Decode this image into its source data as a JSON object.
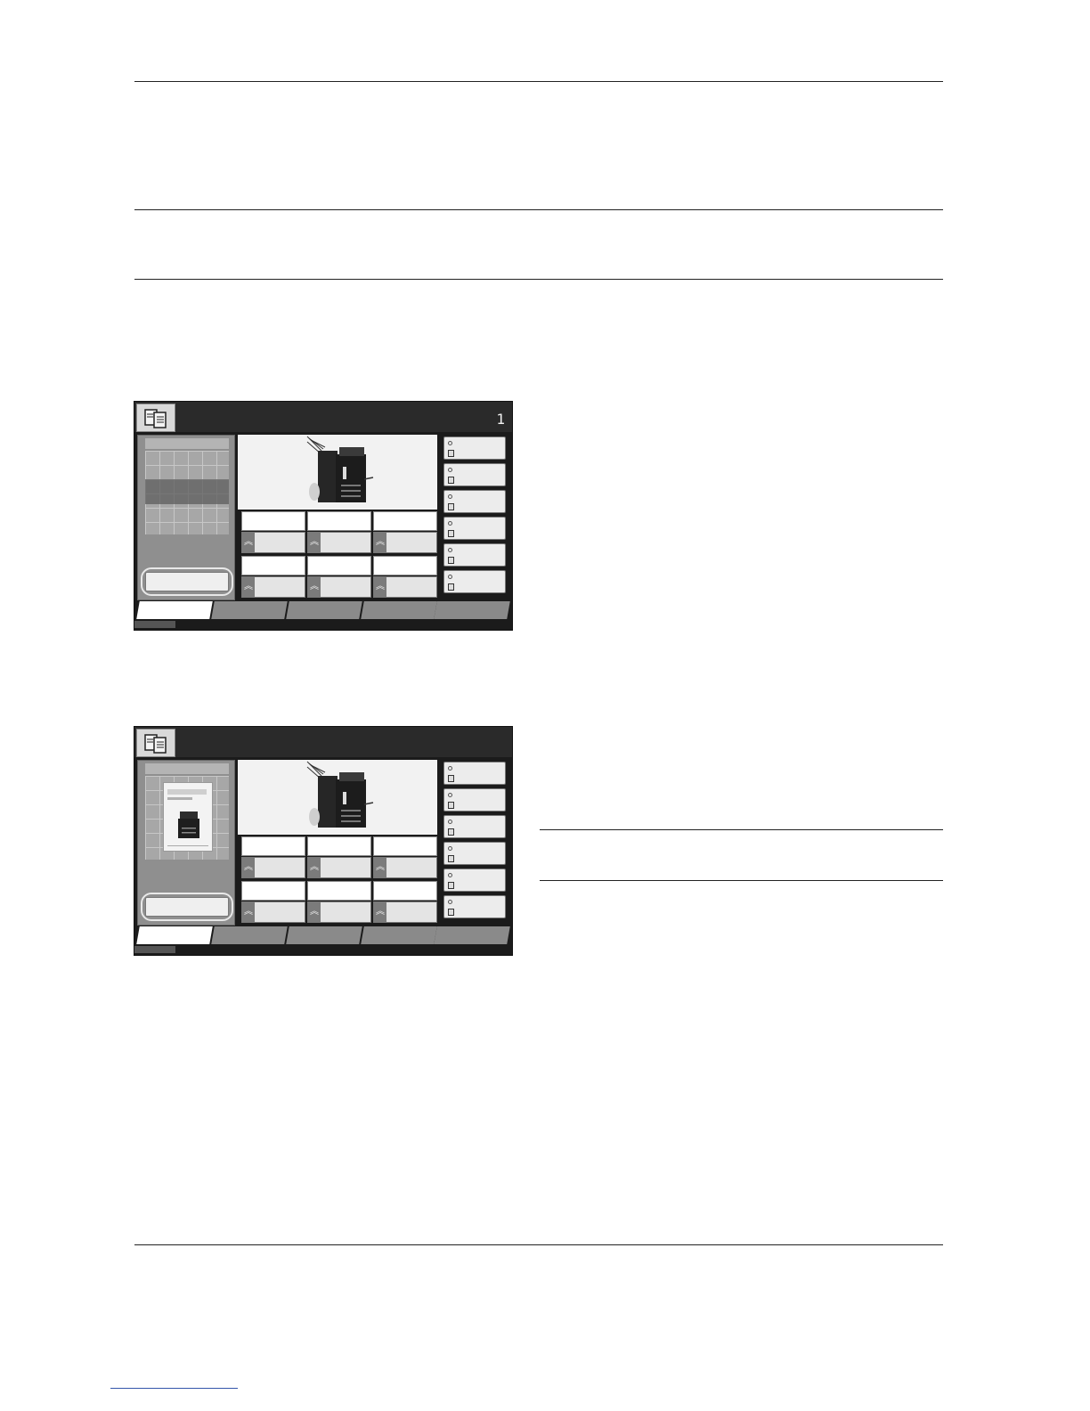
{
  "panels": [
    {
      "copies_count": "1",
      "preview_state": "original-not-scanned",
      "highlighted_key": "preview-button"
    },
    {
      "copies_count": "",
      "preview_state": "preview-displayed",
      "highlighted_key": "preview-button"
    }
  ],
  "icons": {
    "mode": "copy-icon",
    "function_key": "chevron-up-icon",
    "side_key_status": "circle-icon",
    "side_key_favorite": "favorite-icon"
  },
  "colors": {
    "screen_frame": "#1b1b1b",
    "title_bar": "#2a2a2a",
    "page_rule": "#222222",
    "footer_link_rule": "#3355aa"
  }
}
